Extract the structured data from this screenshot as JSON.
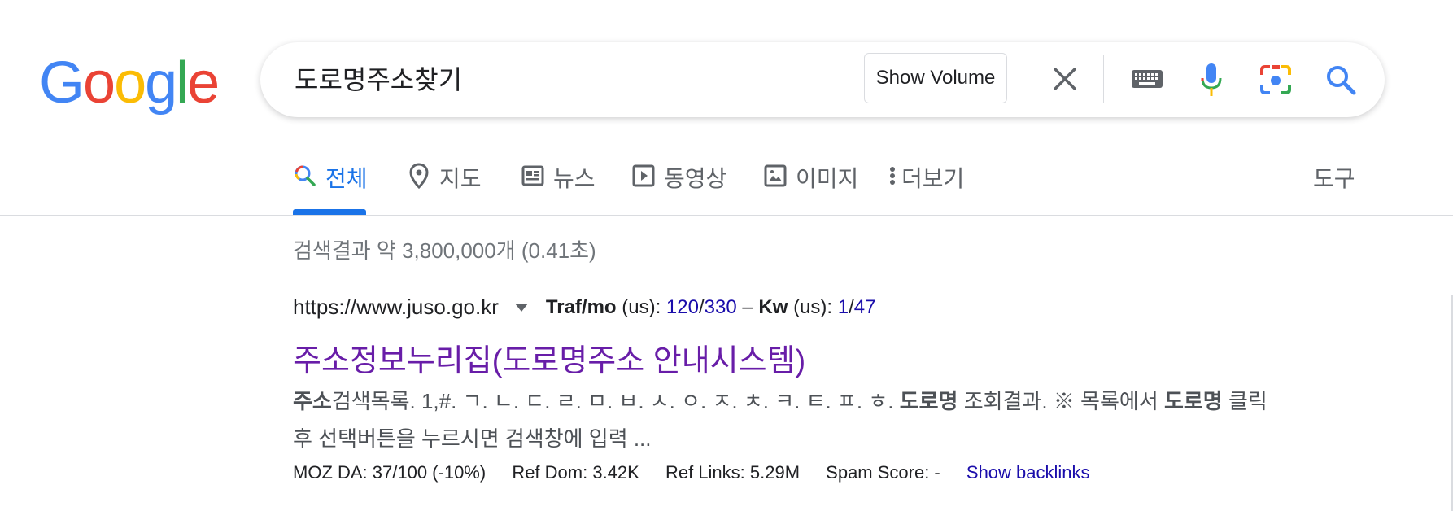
{
  "logo": {
    "letters": [
      "G",
      "o",
      "o",
      "g",
      "l",
      "e"
    ],
    "colors": [
      "#4285F4",
      "#EA4335",
      "#FBBC05",
      "#4285F4",
      "#34A853",
      "#EA4335"
    ]
  },
  "search": {
    "query": "도로명주소찾기",
    "show_volume_label": "Show Volume",
    "icons": [
      "close-icon",
      "keyboard-icon",
      "mic-icon",
      "camera-icon",
      "search-icon"
    ]
  },
  "tabs": [
    {
      "label": "전체",
      "icon": "search-icon",
      "active": true
    },
    {
      "label": "지도",
      "icon": "map-pin-icon"
    },
    {
      "label": "뉴스",
      "icon": "news-icon"
    },
    {
      "label": "동영상",
      "icon": "play-icon"
    },
    {
      "label": "이미지",
      "icon": "image-icon"
    },
    {
      "label": "더보기",
      "icon": "more-vert-icon"
    }
  ],
  "tools_label": "도구",
  "stats": "검색결과 약 3,800,000개 (0.41초)",
  "result": {
    "url": "https://www.juso.go.kr",
    "seo": {
      "traf_label": "Traf/mo",
      "traf_region": "(us):",
      "traf_value": "120",
      "traf_sep": "/",
      "traf_value2": "330",
      "dash": "–",
      "kw_label": "Kw",
      "kw_region": "(us):",
      "kw_value": "1",
      "kw_sep": "/",
      "kw_value2": "47"
    },
    "title": "주소정보누리집(도로명주소 안내시스템)",
    "snippet": {
      "b1": "주소",
      "t1": "검색목록. 1,#. ㄱ. ㄴ. ㄷ. ㄹ. ㅁ. ㅂ. ㅅ. ㅇ. ㅈ. ㅊ. ㅋ. ㅌ. ㅍ. ㅎ. ",
      "b2": "도로명",
      "t2": " 조회결과. ※ 목록에서 ",
      "b3": "도로명",
      "t3": " 클릭 후 선택버튼을 누르시면 검색창에 입력 ..."
    },
    "metrics": {
      "moz": "MOZ DA: 37/100 (-10%)",
      "ref_dom": "Ref Dom: 3.42K",
      "ref_links": "Ref Links: 5.29M",
      "spam": "Spam Score: -",
      "backlinks": "Show backlinks"
    }
  }
}
